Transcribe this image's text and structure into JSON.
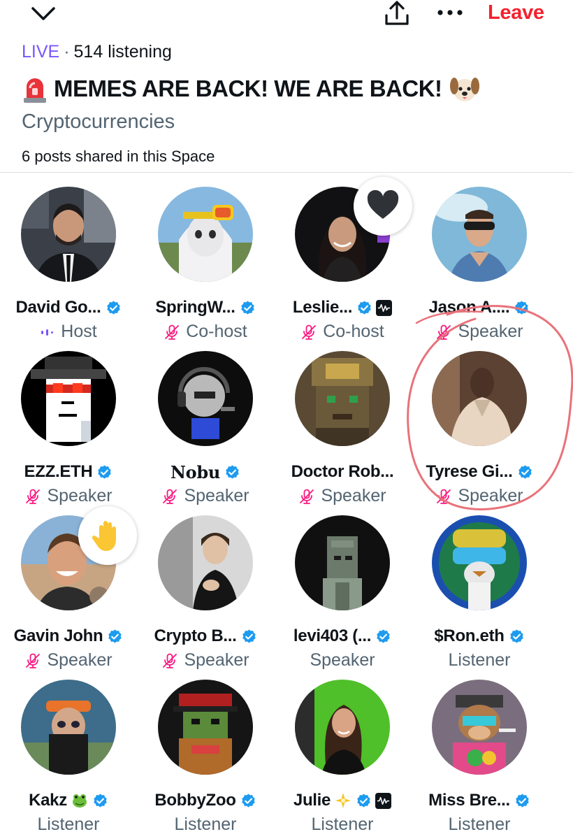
{
  "header": {
    "collapse_icon": "chevron-down-icon",
    "share_icon": "share-icon",
    "more_icon": "more-horizontal-icon",
    "leave_label": "Leave",
    "leave_color": "#f4212e"
  },
  "space": {
    "live_label": "LIVE",
    "separator": "·",
    "listening": "514 listening",
    "title": "MEMES ARE BACK! WE ARE BACK!",
    "title_prefix_emoji": "siren-emoji",
    "title_suffix_emoji": "dog-emoji",
    "topic": "Cryptocurrencies",
    "posts_shared": "6 posts shared in this Space",
    "accent_color": "#7856ff"
  },
  "participants": [
    {
      "name": "David Go...",
      "role": "Host",
      "verified": true,
      "role_icon": "host-speaking-icon"
    },
    {
      "name": "SpringW...",
      "role": "Co-host",
      "verified": true,
      "role_icon": "mic-off-icon"
    },
    {
      "name": "Leslie...",
      "role": "Co-host",
      "verified": true,
      "role_icon": "mic-off-icon",
      "reaction": "heart-icon",
      "extra_badge": "audio-badge-icon"
    },
    {
      "name": "Jason A....",
      "role": "Speaker",
      "verified": true,
      "role_icon": "mic-off-icon"
    },
    {
      "name": "EZZ.ETH",
      "role": "Speaker",
      "verified": true,
      "role_icon": "mic-off-icon"
    },
    {
      "name": "Nobu",
      "role": "Speaker",
      "verified": true,
      "role_icon": "mic-off-icon"
    },
    {
      "name": "Doctor Rob...",
      "role": "Speaker",
      "verified": false,
      "role_icon": "mic-off-icon"
    },
    {
      "name": "Tyrese Gi...",
      "role": "Speaker",
      "verified": true,
      "role_icon": "mic-off-icon"
    },
    {
      "name": "Gavin John",
      "role": "Speaker",
      "verified": true,
      "role_icon": "mic-off-icon",
      "reaction": "raised-hand-icon"
    },
    {
      "name": "Crypto B...",
      "role": "Speaker",
      "verified": true,
      "role_icon": "mic-off-icon"
    },
    {
      "name": "levi403 (...",
      "role": "Speaker",
      "verified": true,
      "role_icon": ""
    },
    {
      "name": "$Ron.eth",
      "role": "Listener",
      "verified": true,
      "role_icon": ""
    },
    {
      "name": "Kakz",
      "role": "Listener",
      "verified": true,
      "role_icon": "",
      "emoji": "frog-emoji"
    },
    {
      "name": "BobbyZoo",
      "role": "Listener",
      "verified": true,
      "role_icon": ""
    },
    {
      "name": "Julie",
      "role": "Listener",
      "verified": true,
      "role_icon": "",
      "emoji": "sparkle-star-emoji",
      "extra_badge": "audio-badge-icon"
    },
    {
      "name": "Miss Bre...",
      "role": "Listener",
      "verified": true,
      "role_icon": ""
    }
  ],
  "colors": {
    "verified_blue": "#1d9bf0",
    "mic_off_pink": "#f91880",
    "annotation_red": "#e8727a"
  }
}
